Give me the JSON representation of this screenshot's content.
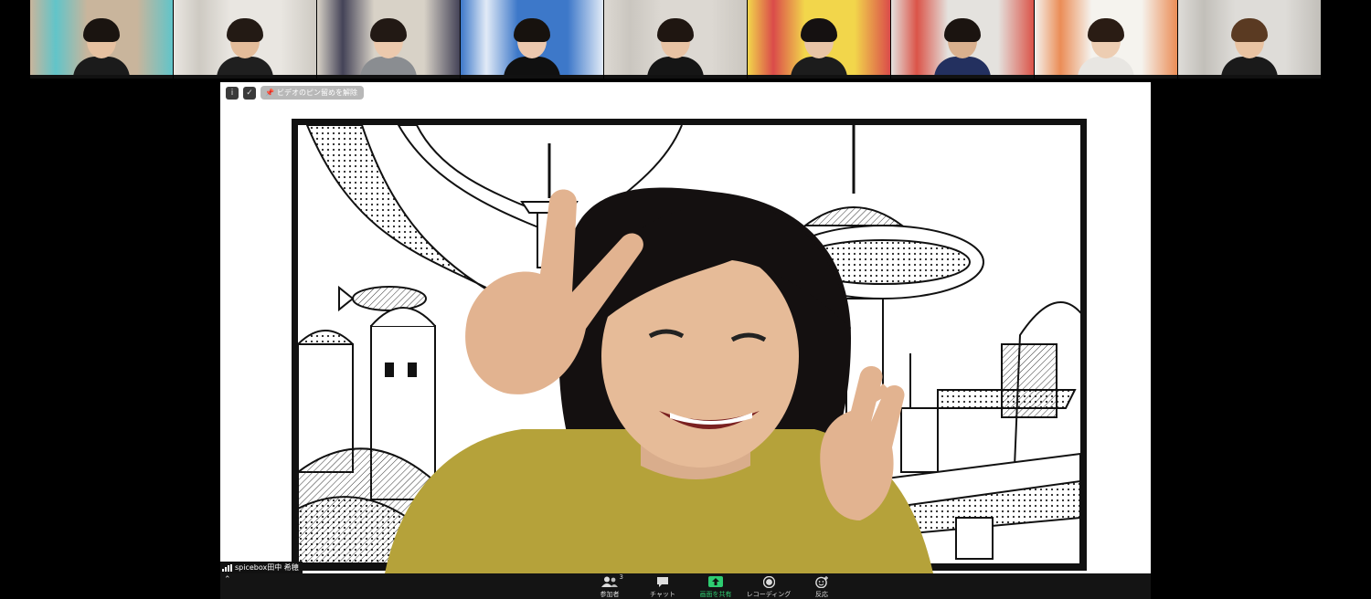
{
  "participants": [
    {
      "bg": "#c9b59c",
      "accent": "#4fc7d1",
      "hair": "#1a1410",
      "shirt": "#1b1b1b",
      "skin": "#e6c1a1"
    },
    {
      "bg": "#e9e6e1",
      "accent": "#c9c5bd",
      "hair": "#231a14",
      "shirt": "#1f1f1f",
      "skin": "#e3bc9a"
    },
    {
      "bg": "#d8d2c7",
      "accent": "#2a2a44",
      "hair": "#221914",
      "shirt": "#8a8d91",
      "skin": "#ecc9ad"
    },
    {
      "bg": "#3d78c9",
      "accent": "#ffffff",
      "hair": "#17120e",
      "shirt": "#101010",
      "skin": "#ecc8ae"
    },
    {
      "bg": "#dcd8d2",
      "accent": "#c7c3bc",
      "hair": "#1f1611",
      "shirt": "#151515",
      "skin": "#e8c3a4"
    },
    {
      "bg": "#f2d64b",
      "accent": "#d6334a",
      "hair": "#151111",
      "shirt": "#1c1c1c",
      "skin": "#e9c5a6"
    },
    {
      "bg": "#e4e2de",
      "accent": "#d93b2e",
      "hair": "#1b1410",
      "shirt": "#23305f",
      "skin": "#d9b08e"
    },
    {
      "bg": "#f5f3ee",
      "accent": "#e97b3c",
      "hair": "#2a1c14",
      "shirt": "#e8e6e2",
      "skin": "#edcdb2"
    },
    {
      "bg": "#dedcd8",
      "accent": "#bdbab4",
      "hair": "#5a3a22",
      "shirt": "#1a1a1a",
      "skin": "#e9c3a2"
    }
  ],
  "pin": {
    "unpin_label": "ビデオのピン留めを解除"
  },
  "main_video": {
    "name": "spicebox田中 希穂",
    "background": "manga-city"
  },
  "toolbar": {
    "participants_label": "参加者",
    "participants_count": "3",
    "chat_label": "チャット",
    "share_label": "画面を共有",
    "record_label": "レコーディング",
    "reactions_label": "反応"
  },
  "colors": {
    "share_accent": "#2ecc71",
    "toolbar_bg": "#141414",
    "shirt": "#b5a23a"
  }
}
